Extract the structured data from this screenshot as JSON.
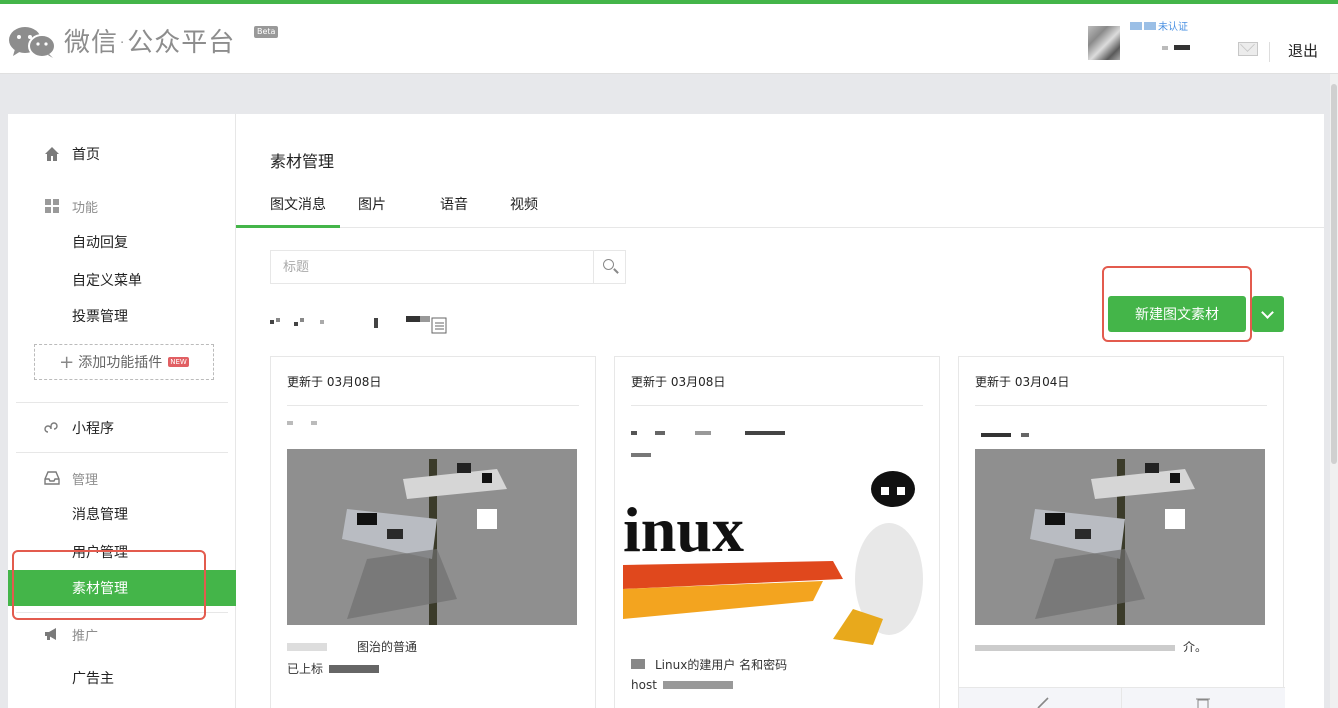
{
  "app": {
    "title": "微信·公众平台",
    "badge": "Beta"
  },
  "account": {
    "verify": "未认证",
    "logout": "退出"
  },
  "sidebar": {
    "home": "首页",
    "function_group": "功能",
    "function_items": [
      "自动回复",
      "自定义菜单",
      "投票管理"
    ],
    "add_plugin": "添加功能插件",
    "new_badge": "NEW",
    "miniprogram": "小程序",
    "manage_group": "管理",
    "manage_items": [
      "消息管理",
      "用户管理",
      "素材管理"
    ],
    "promo_group": "推广",
    "promo_items": [
      "广告主"
    ]
  },
  "main": {
    "title": "素材管理",
    "tabs": [
      "图文消息",
      "图片",
      "语音",
      "视频"
    ],
    "search_placeholder": "标题",
    "new_button": "新建图文素材",
    "cards": [
      {
        "date": "更新于 03月08日",
        "desc1": "图治的普通",
        "desc2": "已上标"
      },
      {
        "date": "更新于 03月08日",
        "banner": "inux",
        "desc1": "Linux的建用户 名和密码",
        "desc2": "host"
      },
      {
        "date": "更新于 03月04日",
        "desc1": "介。"
      }
    ]
  },
  "colors": {
    "brand_green": "#44b549",
    "highlight_red": "#e35b4e"
  }
}
